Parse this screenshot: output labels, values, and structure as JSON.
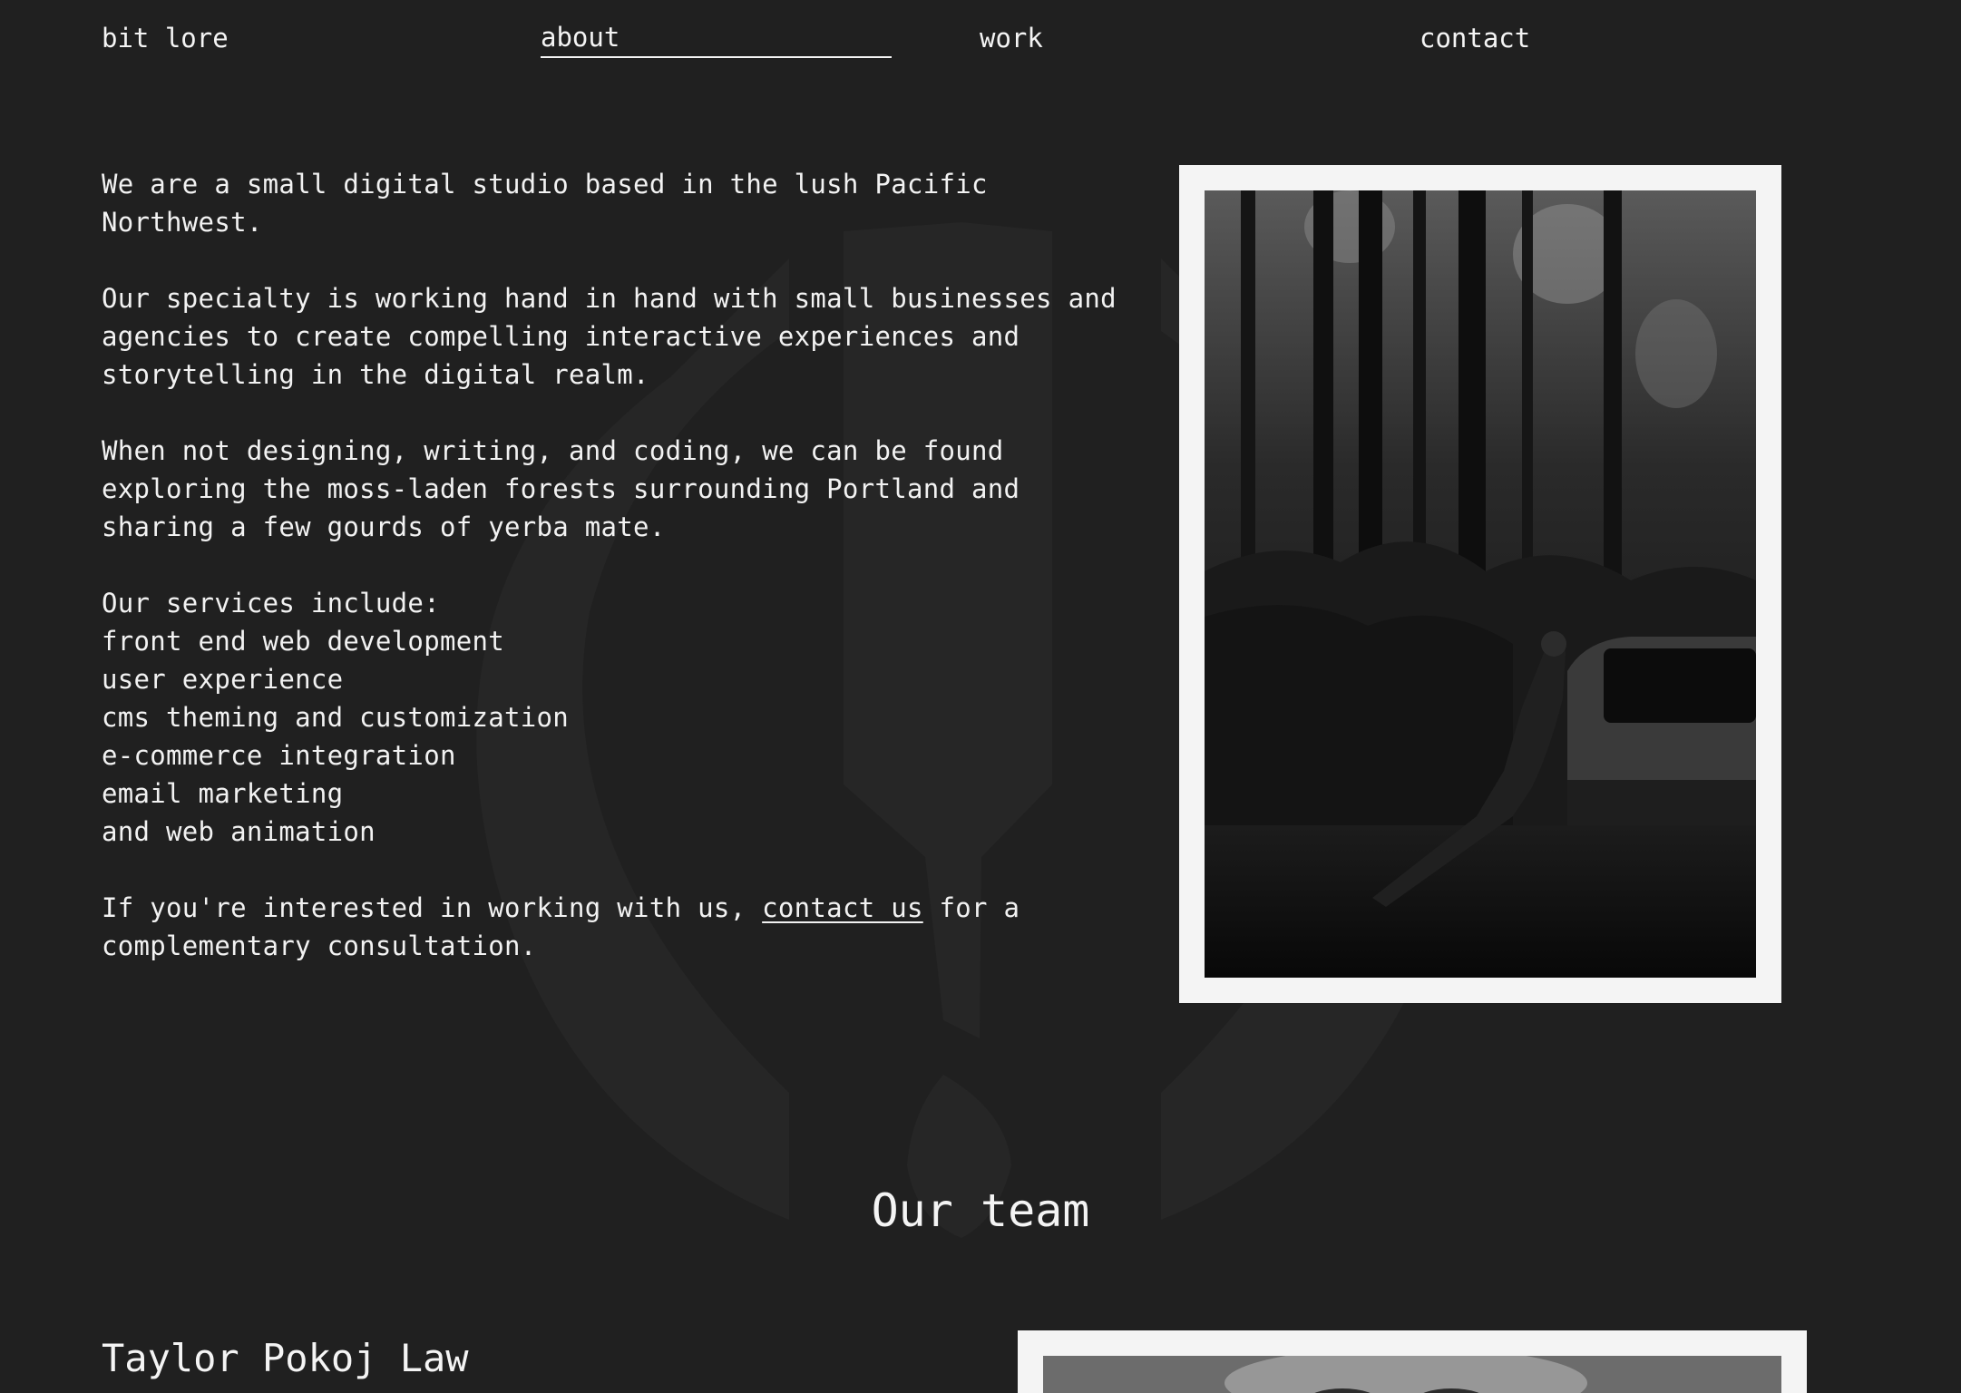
{
  "nav": {
    "brand": "bit lore",
    "about": "about",
    "work": "work",
    "contact": "contact"
  },
  "intro": {
    "paragraph_1": "We are a small digital studio based in the lush Pacific Northwest.",
    "paragraph_2": "Our specialty is working hand in hand with small businesses and agencies to create compelling interactive experiences and storytelling in the digital realm.",
    "paragraph_3": "When not designing, writing, and coding, we can be found exploring the moss-laden forests surrounding Portland and sharing a few gourds of yerba mate.",
    "services_heading": "Our services include:",
    "services": [
      "front end web development",
      "user experience",
      "cms theming and customization",
      "e-commerce integration",
      "email marketing",
      "and web animation"
    ],
    "cta_before": "If you're interested in working with us, ",
    "cta_link": "contact us",
    "cta_after": " for a complementary consultation."
  },
  "team": {
    "heading": "Our team",
    "members": [
      {
        "name": "Taylor Pokoj Law"
      }
    ]
  },
  "colors": {
    "background": "#202020",
    "text": "#f2f2f2",
    "frame": "#f4f4f4"
  }
}
